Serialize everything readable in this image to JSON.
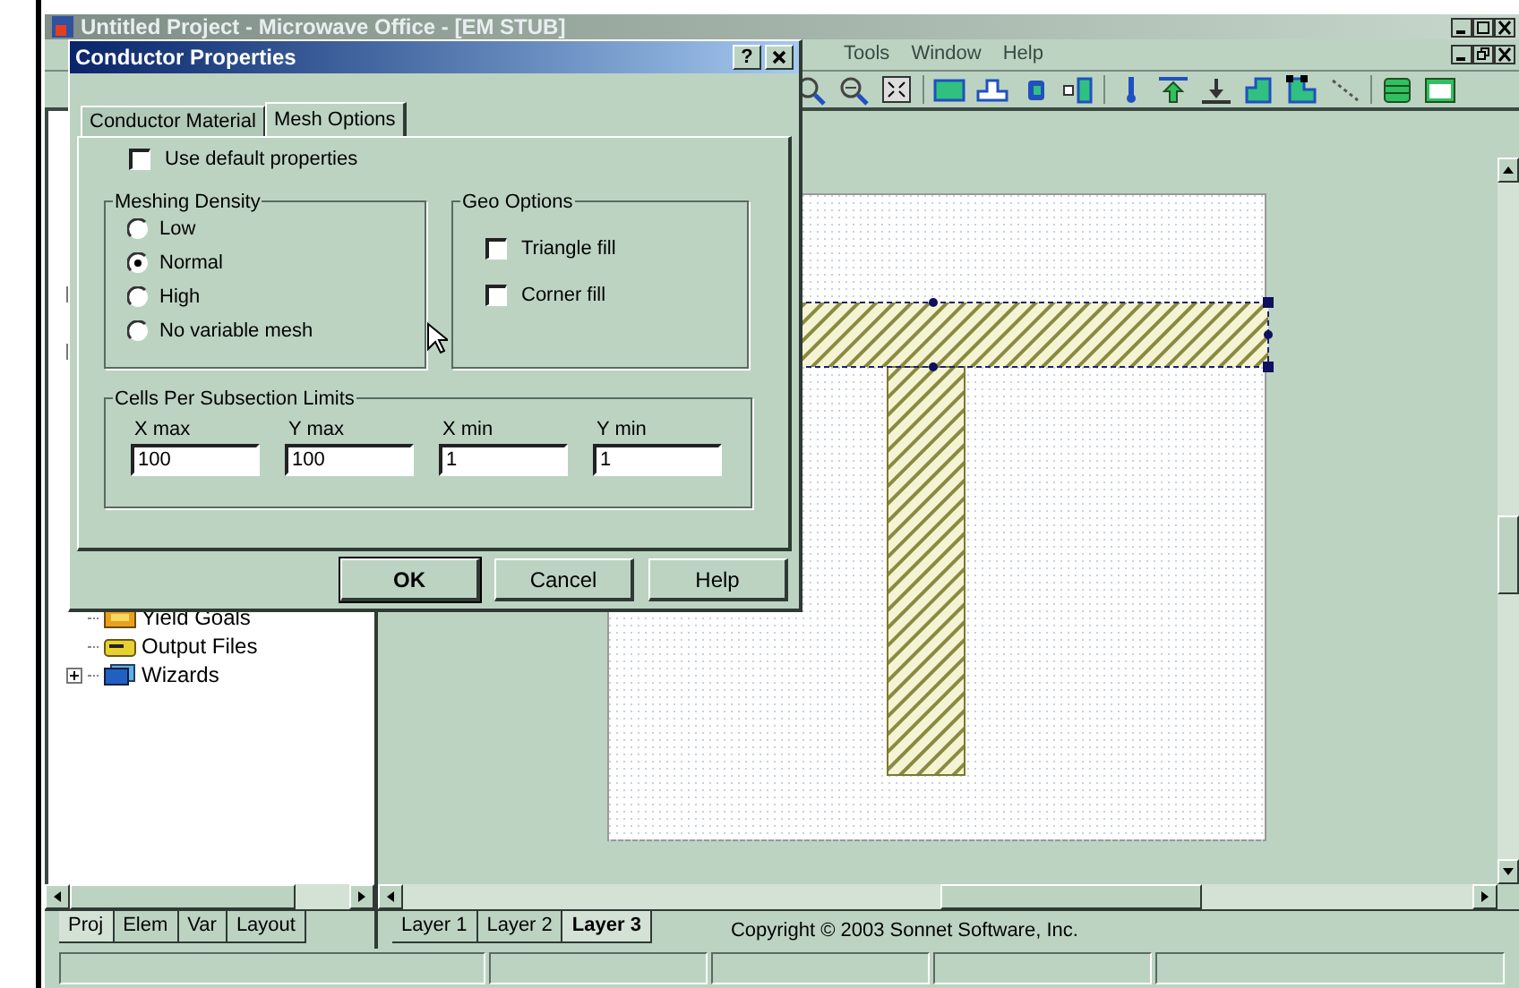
{
  "app": {
    "title": "Untitled Project - Microwave Office - [EM STUB]"
  },
  "menu": [
    "Tools",
    "Window",
    "Help"
  ],
  "tree": {
    "items": [
      {
        "label": "Yield Goals",
        "kind": "goals",
        "expandable": false
      },
      {
        "label": "Output Files",
        "kind": "files",
        "expandable": false
      },
      {
        "label": "Wizards",
        "kind": "wizard",
        "expandable": true
      }
    ]
  },
  "left_tabs": [
    {
      "label": "Proj",
      "selected": true
    },
    {
      "label": "Elem",
      "selected": false
    },
    {
      "label": "Var",
      "selected": false
    },
    {
      "label": "Layout",
      "selected": false
    }
  ],
  "layer_tabs": [
    {
      "label": "Layer 1",
      "selected": false
    },
    {
      "label": "Layer 2",
      "selected": false
    },
    {
      "label": "Layer 3",
      "selected": true
    }
  ],
  "status_text": "Copyright © 2003 Sonnet Software, Inc.",
  "dialog": {
    "title": "Conductor Properties",
    "help_button": "?",
    "tabs": [
      {
        "label": "Conductor Material",
        "selected": false
      },
      {
        "label": "Mesh Options",
        "selected": true
      }
    ],
    "use_default": {
      "label": "Use default properties",
      "checked": false
    },
    "meshing_density": {
      "title": "Meshing Density",
      "options": [
        {
          "label": "Low",
          "selected": false
        },
        {
          "label": "Normal",
          "selected": true
        },
        {
          "label": "High",
          "selected": false
        },
        {
          "label": "No variable mesh",
          "selected": false
        }
      ]
    },
    "geo_options": {
      "title": "Geo Options",
      "options": [
        {
          "label": "Triangle fill",
          "checked": false
        },
        {
          "label": "Corner fill",
          "checked": false
        }
      ]
    },
    "cells_limits": {
      "title": "Cells Per Subsection Limits",
      "fields": [
        {
          "label": "X max",
          "value": "100"
        },
        {
          "label": "Y max",
          "value": "100"
        },
        {
          "label": "X min",
          "value": "1"
        },
        {
          "label": "Y min",
          "value": "1"
        }
      ]
    },
    "buttons": [
      "OK",
      "Cancel",
      "Help"
    ]
  }
}
